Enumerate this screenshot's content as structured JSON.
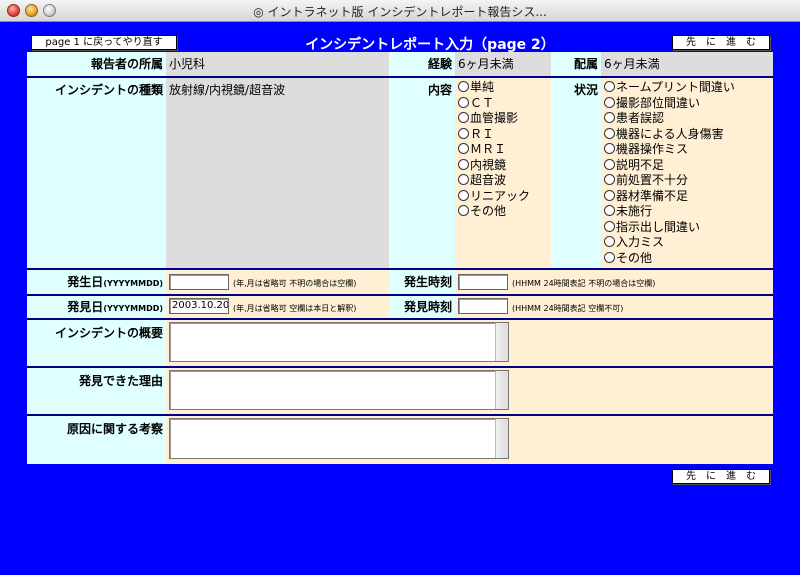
{
  "window": {
    "title": "◎ イントラネット版 インシデントレポート報告シス..."
  },
  "nav": {
    "back_label": "page 1 に戻ってやり直す",
    "next_label": "先　に　進　む",
    "next_bottom_label": "先　に　進　む"
  },
  "page_title": "インシデントレポート入力（page 2）",
  "reporter": {
    "dept_label": "報告者の所属",
    "dept_value": "小児科",
    "exp_label": "経験",
    "exp_value": "6ヶ月未満",
    "assign_label": "配属",
    "assign_value": "6ヶ月未満"
  },
  "incident": {
    "type_label": "インシデントの種類",
    "type_value": "放射線/内視鏡/超音波",
    "content_label": "内容",
    "content_options": [
      "単純",
      "ＣＴ",
      "血管撮影",
      "ＲＩ",
      "ＭＲＩ",
      "内視鏡",
      "超音波",
      "リニアック",
      "その他"
    ],
    "status_label": "状況",
    "status_options": [
      "ネームプリント間違い",
      "撮影部位間違い",
      "患者誤認",
      "機器による人身傷害",
      "機器操作ミス",
      "説明不足",
      "前処置不十分",
      "器材準備不足",
      "未施行",
      "指示出し間違い",
      "入力ミス",
      "その他"
    ]
  },
  "occurrence": {
    "date_label": "発生日",
    "date_unit": "(YYYYMMDD)",
    "date_value": "",
    "date_note": "(年,月は省略可 不明の場合は空欄)",
    "time_label": "発生時刻",
    "time_value": "",
    "time_note": "(HHMM 24時間表記 不明の場合は空欄)"
  },
  "discovery": {
    "date_label": "発見日",
    "date_unit": "(YYYYMMDD)",
    "date_value": "2003.10.20",
    "date_note": "(年,月は省略可 空欄は本日と解釈)",
    "time_label": "発見時刻",
    "time_value": "",
    "time_note": "(HHMM 24時間表記 空欄不可)"
  },
  "summary_label": "インシデントの概要",
  "reason_label": "発見できた理由",
  "cause_label": "原因に関する考察"
}
